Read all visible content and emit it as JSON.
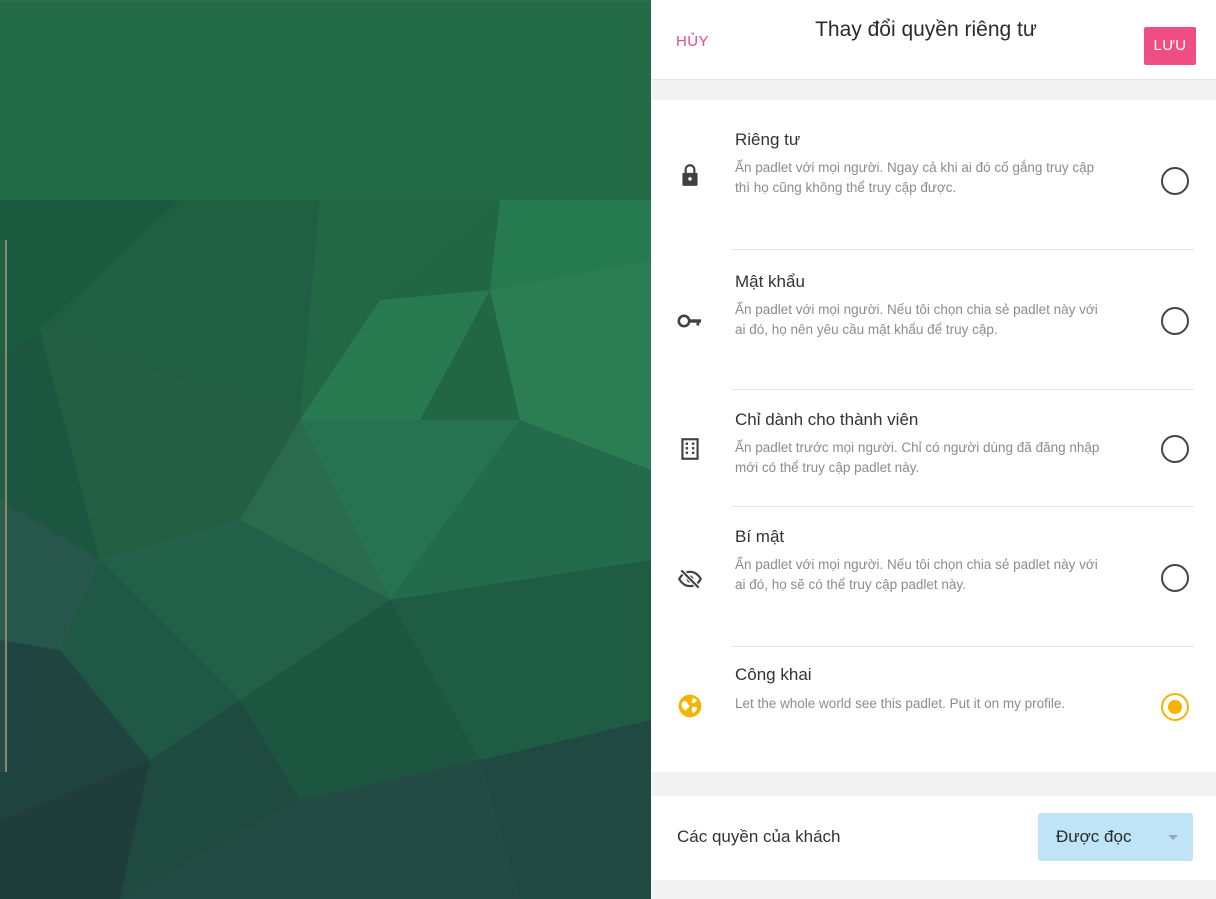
{
  "dialog": {
    "cancel_label": "HỦY",
    "title": "Thay đổi quyền riêng tư",
    "save_label": "LƯU"
  },
  "options": [
    {
      "title": "Riêng tư",
      "description": "Ẩn padlet với mọi người. Ngay cả khi ai đó cố gắng truy cập thì họ cũng không thể truy cập được.",
      "icon": "lock-icon",
      "selected": false
    },
    {
      "title": "Mật khẩu",
      "description": "Ẩn padlet với mọi người. Nếu tôi chọn chia sẻ padlet này với ai đó, họ nên yêu cầu mật khẩu để truy cập.",
      "icon": "key-icon",
      "selected": false
    },
    {
      "title": "Chỉ dành cho thành viên",
      "description": "Ẩn padlet trước mọi người. Chỉ có người dùng đã đăng nhập mới có thể truy cập padlet này.",
      "icon": "building-icon",
      "selected": false
    },
    {
      "title": "Bí mật",
      "description": "Ẩn padlet với mọi người. Nếu tôi chọn chia sẻ padlet này với ai đó, họ sẽ có thể truy cập padlet này.",
      "icon": "eye-off-icon",
      "selected": false
    },
    {
      "title": "Công khai",
      "description": "Let the whole world see this padlet. Put it on my profile.",
      "icon": "globe-icon",
      "selected": true
    }
  ],
  "guest": {
    "label": "Các quyền của khách",
    "value": "Được đọc"
  },
  "colors": {
    "accent_pink": "#ef4d83",
    "selected_yellow": "#f4b400",
    "select_bg": "#bfe3f7",
    "background_green": "#246a45"
  }
}
